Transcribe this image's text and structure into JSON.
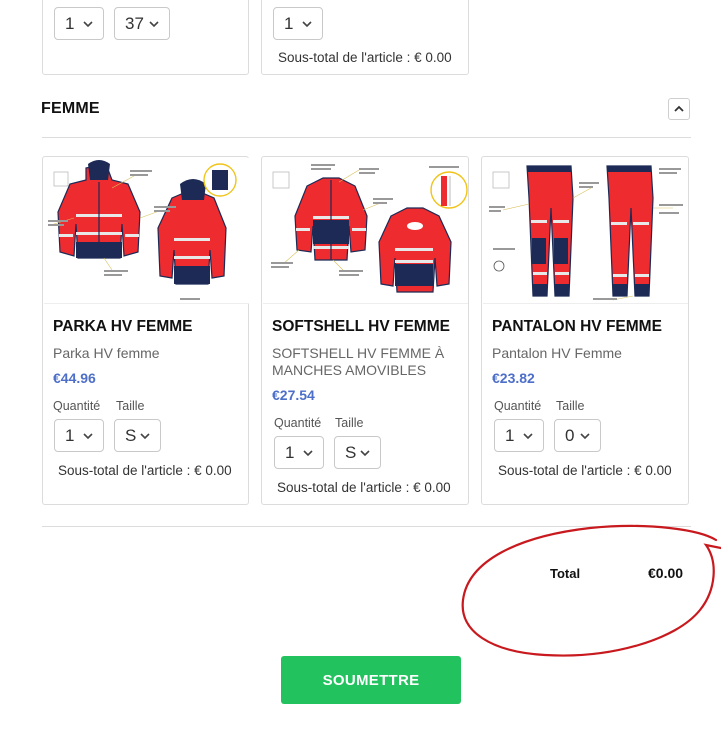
{
  "top_row": {
    "card1": {
      "quantity": "1",
      "size": "37"
    },
    "card2": {
      "quantity": "1",
      "subtotal": "Sous-total de l'article : € 0.00"
    }
  },
  "section": {
    "title": "FEMME"
  },
  "labels": {
    "quantity": "Quantité",
    "size": "Taille"
  },
  "products": [
    {
      "title": "PARKA HV FEMME",
      "description": "Parka HV femme",
      "price": "€44.96",
      "quantity": "1",
      "size": "S",
      "subtotal": "Sous-total de l'article : € 0.00"
    },
    {
      "title": "SOFTSHELL HV FEMME",
      "description": "SOFTSHELL HV FEMME À MANCHES AMOVIBLES",
      "price": "€27.54",
      "quantity": "1",
      "size": "S",
      "subtotal": "Sous-total de l'article : € 0.00"
    },
    {
      "title": "PANTALON HV FEMME",
      "description": "Pantalon HV Femme",
      "price": "€23.82",
      "quantity": "1",
      "size": "0",
      "subtotal": "Sous-total de l'article : € 0.00"
    }
  ],
  "total": {
    "label": "Total",
    "value": "€0.00"
  },
  "submit_label": "SOUMETTRE",
  "colors": {
    "accent_green": "#22c35e",
    "price_blue": "#4d6fc9",
    "hv_red": "#ee2b2f",
    "hv_navy": "#1c2a55",
    "annotation_red": "#c8191e"
  }
}
